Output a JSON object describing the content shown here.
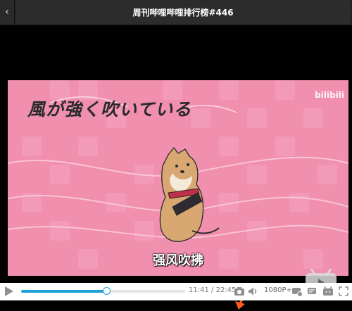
{
  "header": {
    "back_icon": "chevron-left-icon",
    "title": "周刊哔哩哔哩排行榜#446"
  },
  "video": {
    "overlay_title": "風が強く吹いている",
    "watermark": "bilibili",
    "subtitle": "强风吹拂",
    "background_color": "#f08fae"
  },
  "controls": {
    "current_time": "11:41",
    "separator": "/",
    "total_time": "22:45",
    "progress": 0.52,
    "quality": "1080P+",
    "accent_color": "#1ea0d8",
    "icons": [
      "play-icon",
      "screenshot-icon",
      "volume-icon",
      "settings-icon",
      "danmaku-icon",
      "tv-icon",
      "fullscreen-icon"
    ]
  }
}
